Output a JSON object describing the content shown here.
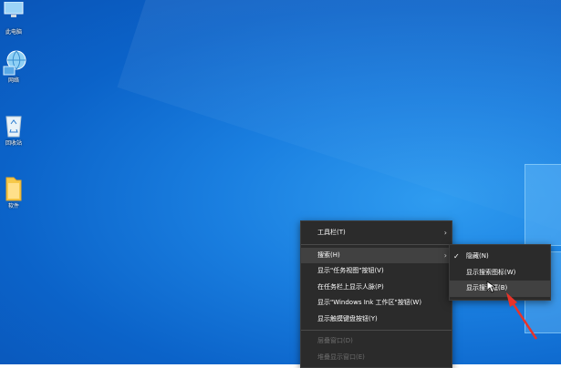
{
  "desktop_icons": [
    {
      "label": "此电脑",
      "icon": "computer-icon"
    },
    {
      "label": "网络",
      "icon": "network-globe-icon"
    },
    {
      "label": "回收站",
      "icon": "recycle-bin-icon"
    },
    {
      "label": "软件",
      "icon": "folder-icon"
    }
  ],
  "context_menu": {
    "items": [
      {
        "label": "工具栏(T)",
        "submenu": true
      },
      {
        "label": "搜索(H)",
        "submenu": true
      },
      {
        "label": "显示\"任务视图\"按钮(V)"
      },
      {
        "label": "在任务栏上显示人脉(P)"
      },
      {
        "label": "显示\"Windows Ink 工作区\"按钮(W)"
      },
      {
        "label": "显示触摸键盘按钮(Y)"
      },
      {
        "label": "层叠窗口(D)",
        "disabled": true
      },
      {
        "label": "堆叠显示窗口(E)",
        "disabled": true
      }
    ]
  },
  "search_submenu": {
    "items": [
      {
        "label": "隐藏(N)",
        "checked": true
      },
      {
        "label": "显示搜索图标(W)"
      },
      {
        "label": "显示搜索框(B)"
      }
    ],
    "check_glyph": "✓"
  },
  "colors": {
    "menu_bg": "#2b2b2b",
    "menu_hover": "#414141",
    "annotation": "#e8332a"
  }
}
